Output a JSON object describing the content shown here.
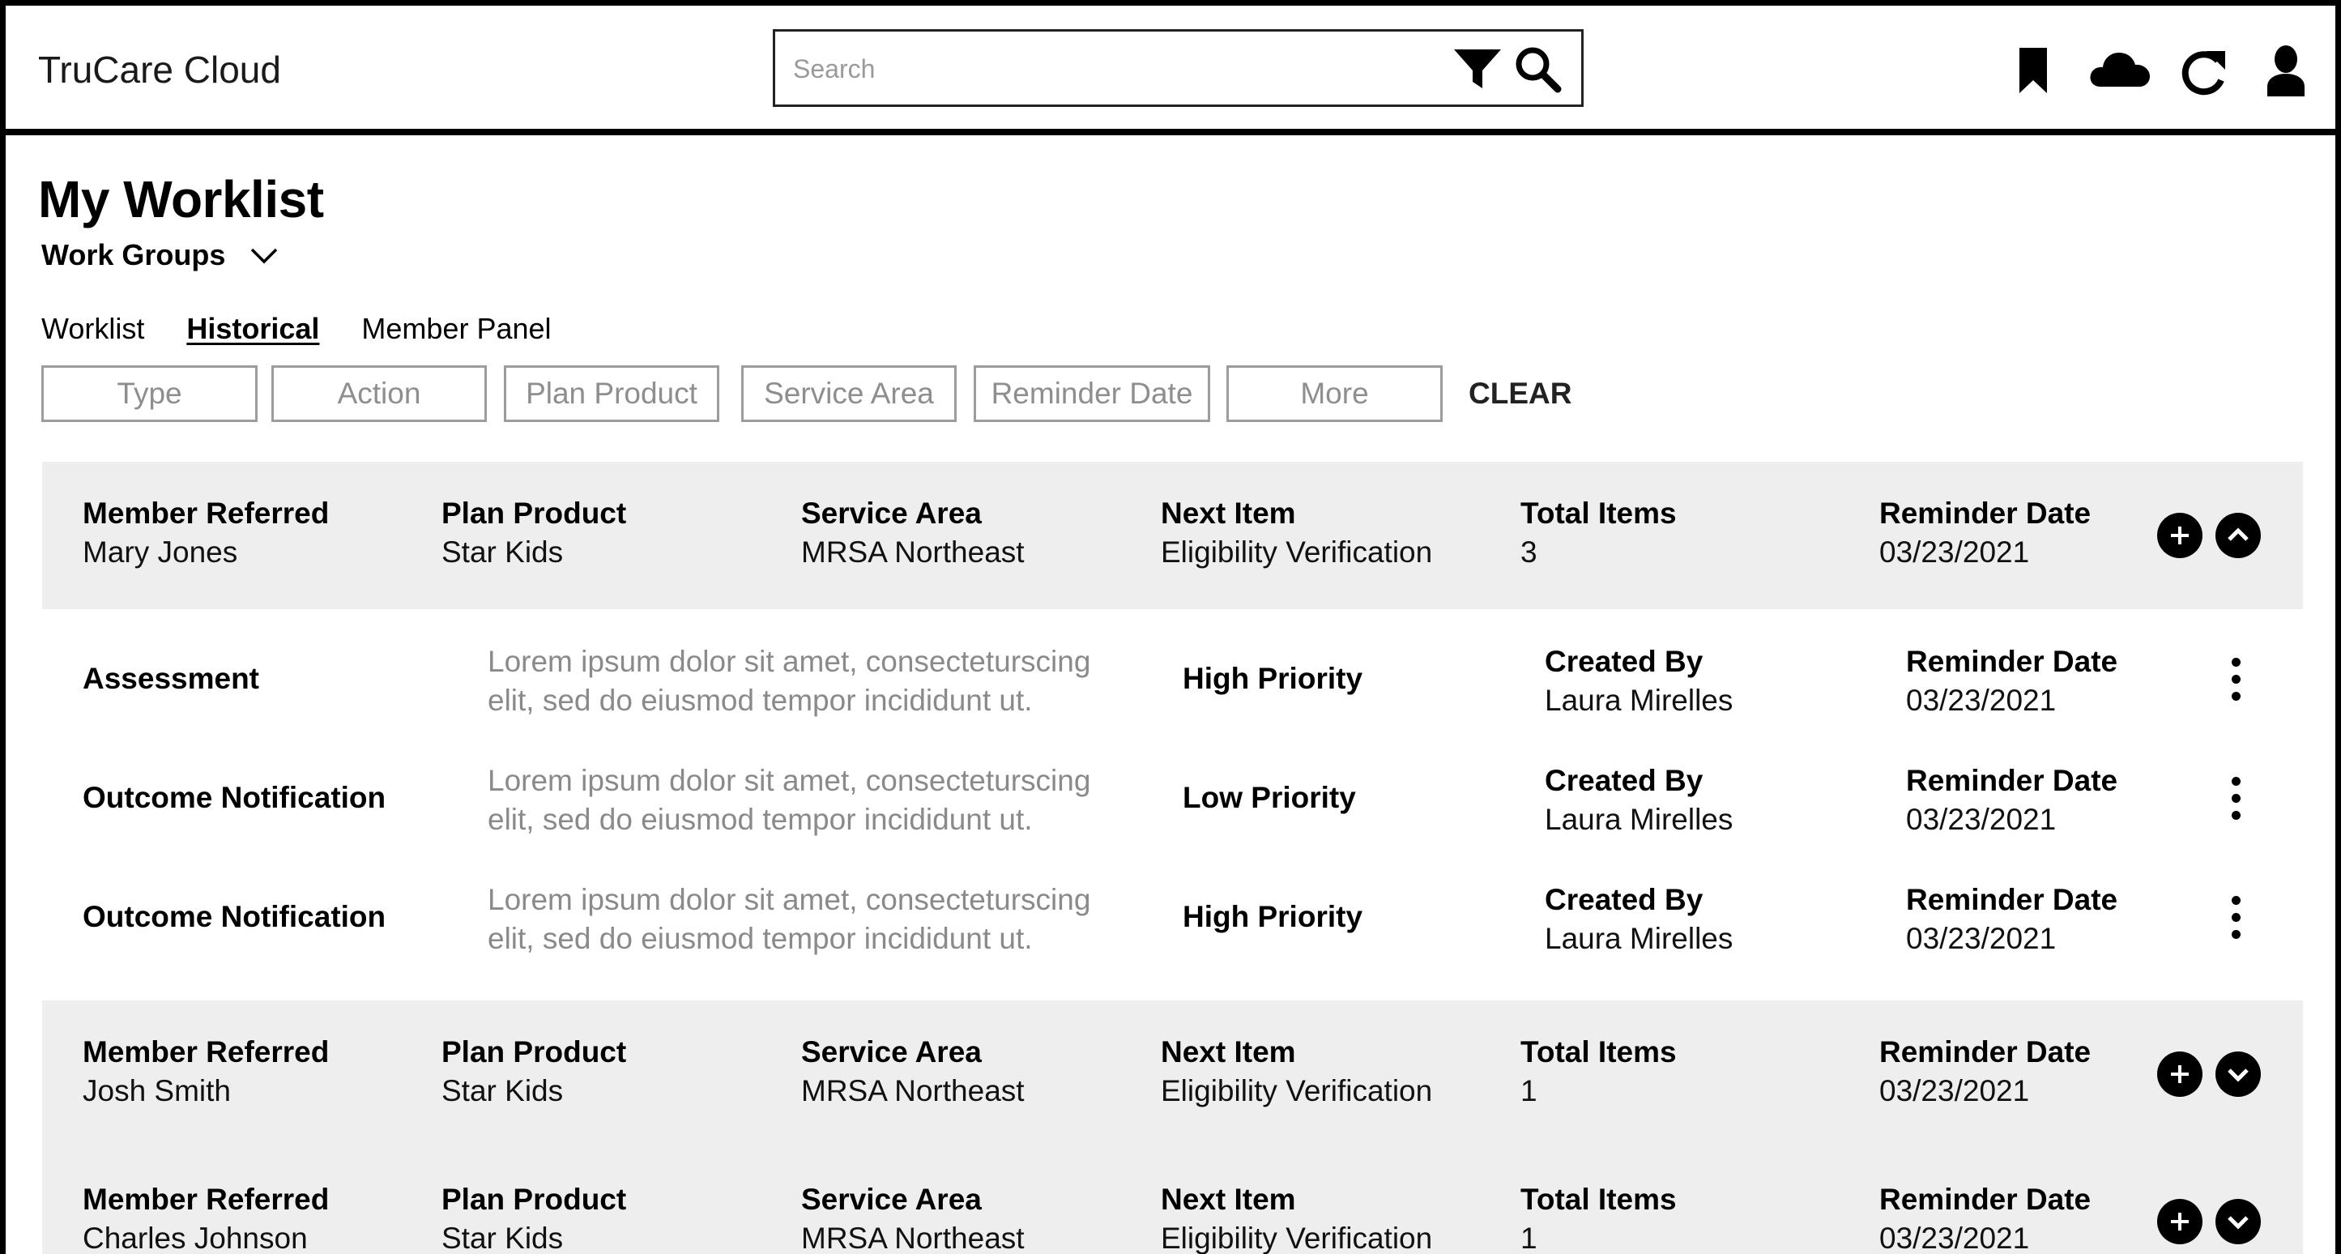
{
  "app": {
    "brand": "TruCare Cloud"
  },
  "search": {
    "placeholder": "Search",
    "value": ""
  },
  "header_icons": [
    "bookmark-icon",
    "cloud-icon",
    "refresh-icon",
    "user-icon"
  ],
  "page": {
    "title": "My Worklist",
    "work_groups_label": "Work Groups"
  },
  "tabs": [
    {
      "label": "Worklist",
      "active": false
    },
    {
      "label": "Historical",
      "active": true
    },
    {
      "label": "Member Panel",
      "active": false
    }
  ],
  "filters": [
    {
      "label": "Type"
    },
    {
      "label": "Action"
    },
    {
      "label": "Plan Product"
    },
    {
      "label": "Service Area"
    },
    {
      "label": "Reminder Date"
    },
    {
      "label": "More"
    }
  ],
  "clear_label": "CLEAR",
  "columns": {
    "member": "Member Referred",
    "plan": "Plan Product",
    "area": "Service Area",
    "next": "Next Item",
    "total": "Total Items",
    "reminder": "Reminder Date"
  },
  "groups": [
    {
      "member": "Mary Jones",
      "plan": "Star Kids",
      "area": "MRSA Northeast",
      "next": "Eligibility Verification",
      "total": "3",
      "reminder": "03/23/2021",
      "expanded": true,
      "tasks": [
        {
          "name": "Assessment",
          "desc_line1": "Lorem ipsum dolor sit amet, consecteturscing",
          "desc_line2": "elit, sed do eiusmod tempor incididunt ut.",
          "priority": "High Priority",
          "created_label": "Created By",
          "created_by": "Laura Mirelles",
          "reminder_label": "Reminder Date",
          "reminder": "03/23/2021"
        },
        {
          "name": "Outcome Notification",
          "desc_line1": "Lorem ipsum dolor sit amet, consecteturscing",
          "desc_line2": "elit, sed do eiusmod tempor incididunt ut.",
          "priority": "Low Priority",
          "created_label": "Created By",
          "created_by": "Laura Mirelles",
          "reminder_label": "Reminder Date",
          "reminder": "03/23/2021"
        },
        {
          "name": "Outcome Notification",
          "desc_line1": "Lorem ipsum dolor sit amet, consecteturscing",
          "desc_line2": "elit, sed do eiusmod tempor incididunt ut.",
          "priority": "High Priority",
          "created_label": "Created By",
          "created_by": "Laura Mirelles",
          "reminder_label": "Reminder Date",
          "reminder": "03/23/2021"
        }
      ]
    },
    {
      "member": "Josh Smith",
      "plan": "Star Kids",
      "area": "MRSA Northeast",
      "next": "Eligibility Verification",
      "total": "1",
      "reminder": "03/23/2021",
      "expanded": false,
      "tasks": []
    },
    {
      "member": "Charles Johnson",
      "plan": "Star Kids",
      "area": "MRSA Northeast",
      "next": "Eligibility Verification",
      "total": "1",
      "reminder": "03/23/2021",
      "expanded": false,
      "tasks": []
    }
  ]
}
